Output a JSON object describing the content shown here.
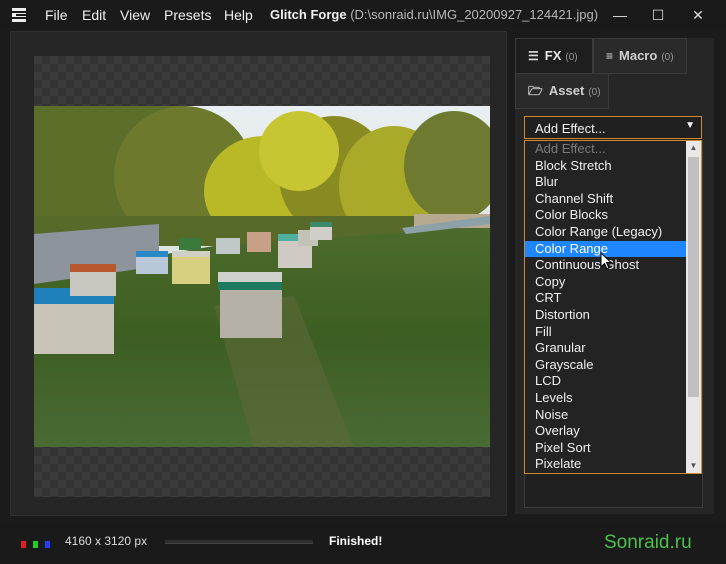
{
  "menu": {
    "items": [
      "File",
      "Edit",
      "View",
      "Presets",
      "Help"
    ],
    "app_title": "Glitch Forge",
    "file_path": "(D:\\sonraid.ru\\IMG_20200927_124421.jpg)"
  },
  "window_controls": {
    "minimize": "—",
    "maximize": "☐",
    "close": "✕"
  },
  "tabs": {
    "fx": {
      "label": "FX",
      "count": "(0)",
      "icon": "layers-icon"
    },
    "macro": {
      "label": "Macro",
      "count": "(0)",
      "icon": "list-icon"
    },
    "asset": {
      "label": "Asset",
      "count": "(0)",
      "icon": "folder-icon"
    }
  },
  "effect_select": {
    "value": "Add Effect...",
    "options": [
      "Add Effect...",
      "Block Stretch",
      "Blur",
      "Channel Shift",
      "Color Blocks",
      "Color Range (Legacy)",
      "Color Range",
      "Continuous Ghost",
      "Copy",
      "CRT",
      "Distortion",
      "Fill",
      "Granular",
      "Grayscale",
      "LCD",
      "Levels",
      "Noise",
      "Overlay",
      "Pixel Sort",
      "Pixelate"
    ],
    "highlighted": "Color Range"
  },
  "status": {
    "image_size": "4160 x 3120 px",
    "progress": 0,
    "message": "Finished!",
    "channel_colors": [
      "#e02020",
      "#20d020",
      "#2040ff"
    ]
  },
  "watermark": "Sonraid.ru"
}
